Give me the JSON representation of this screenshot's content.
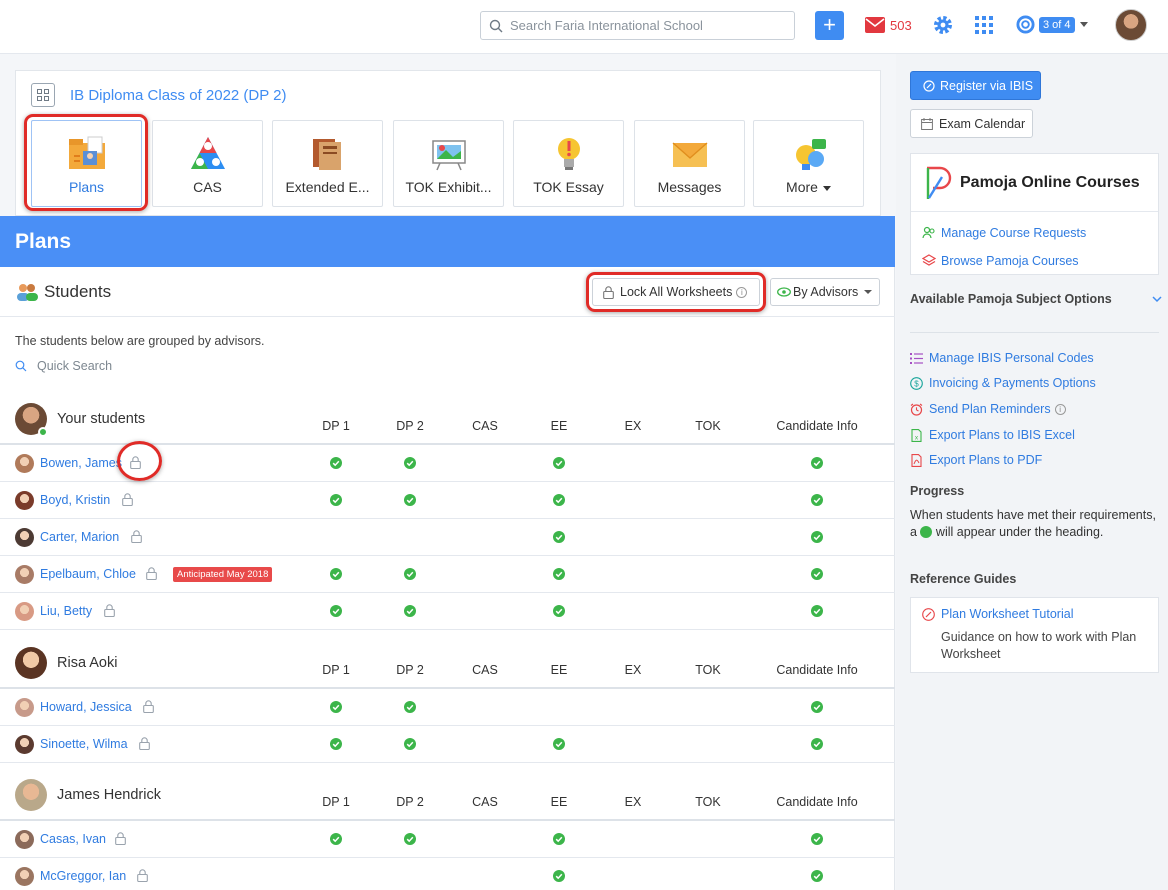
{
  "topbar": {
    "search_placeholder": "Search Faria International School",
    "add_icon": "plus-icon",
    "mail_count": "503",
    "help_badge": "3 of 4",
    "colors": {
      "primary": "#3f8cf2",
      "alert": "#e2383f",
      "success": "#3cb54a"
    }
  },
  "class": {
    "title": "IB Diploma Class of 2022 (DP 2)",
    "tiles": [
      {
        "label": "Plans",
        "icon": "plans-folder-icon",
        "active": true
      },
      {
        "label": "CAS",
        "icon": "cas-triangle-icon"
      },
      {
        "label": "Extended E...",
        "icon": "extended-essay-book-icon"
      },
      {
        "label": "TOK Exhibit...",
        "icon": "tok-exhibition-icon"
      },
      {
        "label": "TOK Essay",
        "icon": "lightbulb-icon"
      },
      {
        "label": "Messages",
        "icon": "envelope-icon"
      },
      {
        "label": "More",
        "icon": "more-apps-icon"
      }
    ]
  },
  "page_title": "Plans",
  "students": {
    "title": "Students",
    "lock_all": "Lock All Worksheets",
    "group_by": "By Advisors",
    "note": "The students below are grouped by advisors.",
    "quick_search_placeholder": "Quick Search",
    "columns": [
      "DP 1",
      "DP 2",
      "CAS",
      "EE",
      "EX",
      "TOK",
      "Candidate Info"
    ],
    "groups": [
      {
        "name": "Your students",
        "rows": [
          {
            "name": "Bowen, James",
            "checks": [
              1,
              1,
              0,
              1,
              0,
              0,
              1
            ]
          },
          {
            "name": "Boyd, Kristin",
            "checks": [
              1,
              1,
              0,
              1,
              0,
              0,
              1
            ]
          },
          {
            "name": "Carter, Marion",
            "checks": [
              0,
              0,
              0,
              1,
              0,
              0,
              1
            ]
          },
          {
            "name": "Epelbaum, Chloe",
            "badge": "Anticipated May 2018",
            "checks": [
              1,
              1,
              0,
              1,
              0,
              0,
              1
            ]
          },
          {
            "name": "Liu, Betty",
            "checks": [
              1,
              1,
              0,
              1,
              0,
              0,
              1
            ]
          }
        ]
      },
      {
        "name": "Risa Aoki",
        "rows": [
          {
            "name": "Howard, Jessica",
            "checks": [
              1,
              1,
              0,
              0,
              0,
              0,
              1
            ]
          },
          {
            "name": "Sinoette, Wilma",
            "checks": [
              1,
              1,
              0,
              1,
              0,
              0,
              1
            ]
          }
        ]
      },
      {
        "name": "James Hendrick",
        "rows": [
          {
            "name": "Casas, Ivan",
            "checks": [
              1,
              1,
              0,
              1,
              0,
              0,
              1
            ]
          },
          {
            "name": "McGreggor, Ian",
            "checks": [
              0,
              0,
              0,
              1,
              0,
              0,
              1
            ]
          }
        ]
      }
    ]
  },
  "sidebar": {
    "register_ibis": "Register via IBIS",
    "exam_calendar": "Exam Calendar",
    "pamoja_title": "Pamoja Online Courses",
    "manage_requests": "Manage Course Requests",
    "browse_courses": "Browse Pamoja Courses",
    "available_options": "Available Pamoja Subject Options",
    "links": [
      "Manage IBIS Personal Codes",
      "Invoicing & Payments Options",
      "Send Plan Reminders",
      "Export Plans to IBIS Excel",
      "Export Plans to PDF"
    ],
    "progress_heading": "Progress",
    "progress_text_before": "When students have met their requirements, a",
    "progress_text_after": "will appear under the heading.",
    "reference_heading": "Reference Guides",
    "ref_title": "Plan Worksheet Tutorial",
    "ref_desc": "Guidance on how to work with Plan Worksheet"
  }
}
